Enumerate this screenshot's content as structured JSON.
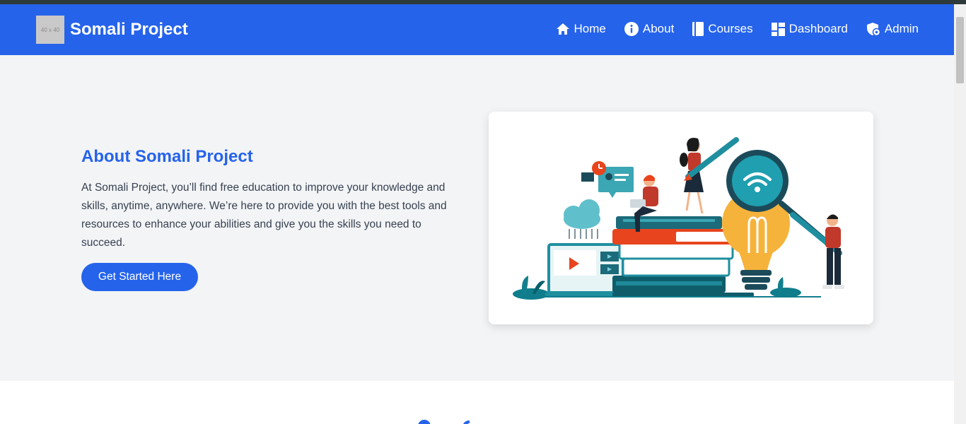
{
  "header": {
    "logo_placeholder": "40 x 40",
    "brand": "Somali Project",
    "nav": [
      {
        "label": "Home",
        "icon": "home-icon"
      },
      {
        "label": "About",
        "icon": "info-icon"
      },
      {
        "label": "Courses",
        "icon": "book-icon"
      },
      {
        "label": "Dashboard",
        "icon": "dashboard-icon"
      },
      {
        "label": "Admin",
        "icon": "admin-shield-icon"
      }
    ]
  },
  "hero": {
    "title": "About Somali Project",
    "text": "At Somali Project, you’ll find free education to improve your knowledge and skills, anytime, anywhere. We’re here to provide you with the best tools and resources to enhance your abilities and give you the skills you need to succeed.",
    "cta": "Get Started Here",
    "illustration": "education-illustration"
  },
  "colors": {
    "primary": "#2563eb",
    "hero_bg": "#f3f4f6",
    "text": "#374151"
  }
}
